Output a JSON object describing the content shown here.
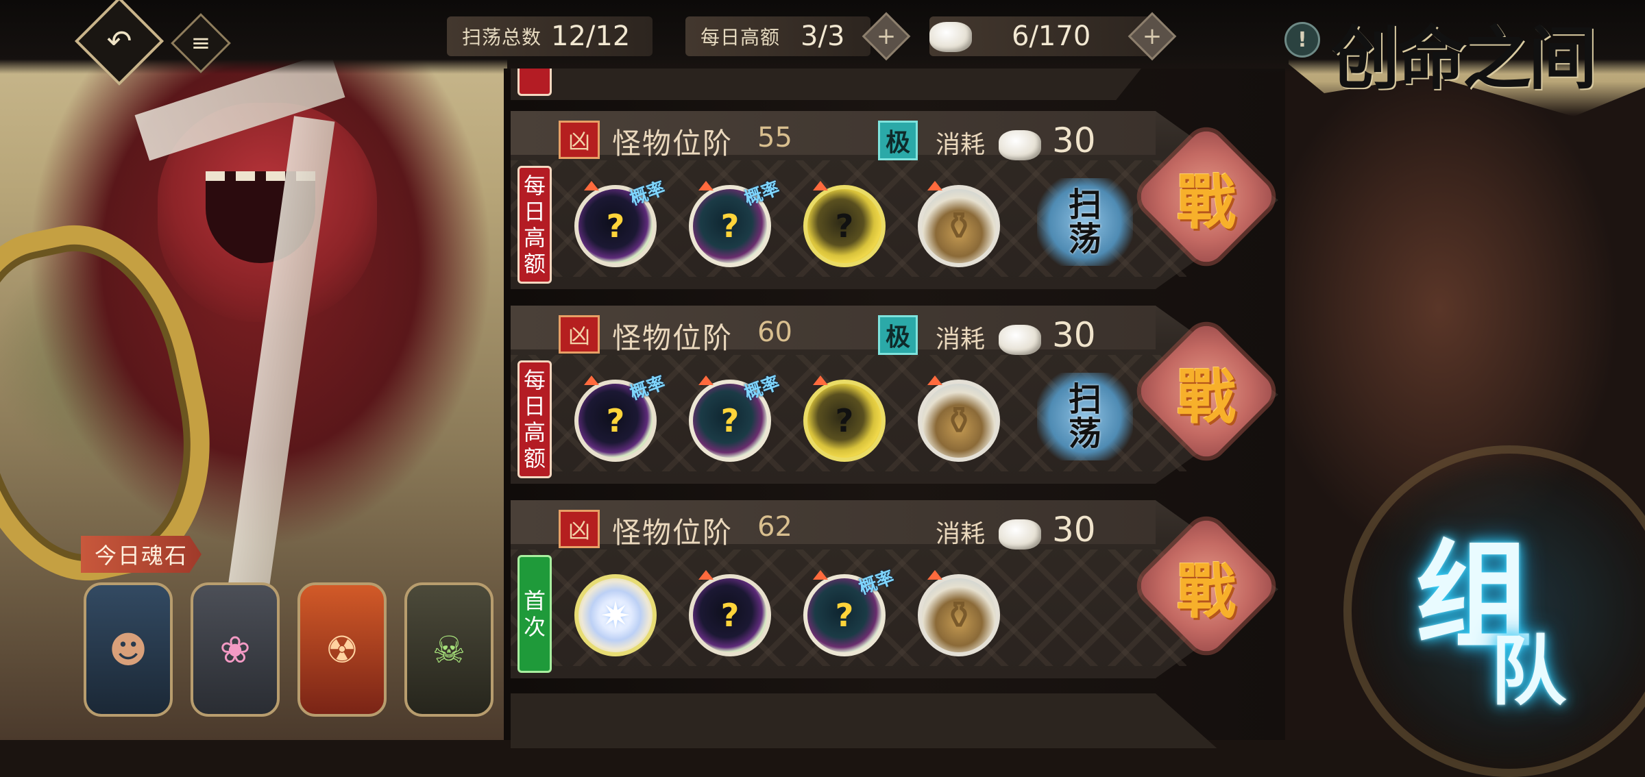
{
  "topbar": {
    "back_icon": "back-arrow-icon",
    "menu_icon": "menu-icon",
    "sweep_total_label": "扫荡总数",
    "sweep_total_value": "12/12",
    "daily_high_label": "每日高额",
    "daily_high_value": "3/3",
    "stone_value": "6/170",
    "plus_icon": "+",
    "info_icon": "!",
    "title": "创命之间"
  },
  "cards": [
    {
      "rank_label": "怪物位阶",
      "rank_value": "55",
      "rank_icon": "凶",
      "badge": "极",
      "cost_label": "消耗",
      "cost_value": "30",
      "tag": [
        "每",
        "日",
        "高",
        "额"
      ],
      "tag_color": "#b41c24",
      "prob_label": "概率",
      "sweep_label_1": "扫",
      "sweep_label_2": "荡",
      "fight_label": "戰"
    },
    {
      "rank_label": "怪物位阶",
      "rank_value": "60",
      "rank_icon": "凶",
      "badge": "极",
      "cost_label": "消耗",
      "cost_value": "30",
      "tag": [
        "每",
        "日",
        "高",
        "额"
      ],
      "tag_color": "#b41c24",
      "prob_label": "概率",
      "sweep_label_1": "扫",
      "sweep_label_2": "荡",
      "fight_label": "戰"
    },
    {
      "rank_label": "怪物位阶",
      "rank_value": "62",
      "rank_icon": "凶",
      "cost_label": "消耗",
      "cost_value": "30",
      "tag": [
        "首",
        "次"
      ],
      "tag_color": "#1f9a3a",
      "prob_label": "概率",
      "fight_label": "戰"
    }
  ],
  "soul_stones": {
    "label": "今日魂石",
    "items": [
      "soul-stone-1",
      "soul-stone-2",
      "soul-stone-3",
      "soul-stone-4"
    ]
  },
  "team_button": {
    "char_1": "组",
    "char_2": "队"
  },
  "colors": {
    "accent_gold": "#f7b02b",
    "team_glow": "#33d6ff",
    "tag_red": "#b41c24",
    "tag_green": "#1f9a3a"
  }
}
